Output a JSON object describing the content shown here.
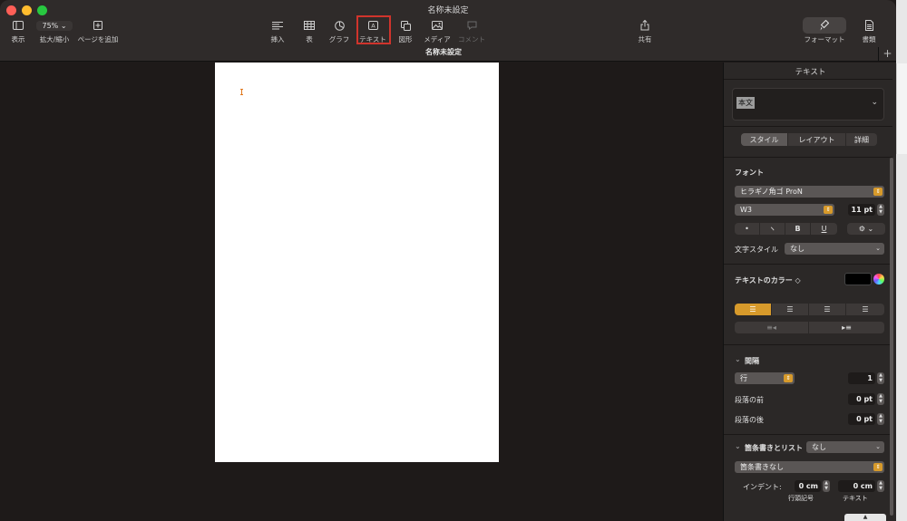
{
  "window": {
    "title": "名称未設定"
  },
  "toolbar": {
    "view_label": "表示",
    "zoom_value": "75%",
    "zoom_label": "拡大/縮小",
    "add_page_label": "ページを追加",
    "insert_label": "挿入",
    "table_label": "表",
    "chart_label": "グラフ",
    "text_label": "テキスト",
    "shape_label": "図形",
    "media_label": "メディア",
    "comment_label": "コメント",
    "share_label": "共有",
    "format_label": "フォーマット",
    "document_label": "書類"
  },
  "document": {
    "tab_title": "名称未設定"
  },
  "inspector": {
    "title": "テキスト",
    "paragraph_style": "本文",
    "tabs": [
      "スタイル",
      "レイアウト",
      "詳細"
    ],
    "font_header": "フォント",
    "font_name": "ヒラギノ角ゴ ProN",
    "font_weight": "W3",
    "font_size": "11 pt",
    "char_style_label": "文字スタイル",
    "char_style_value": "なし",
    "text_color_label": "テキストのカラー ◇",
    "spacing_header": "間隔",
    "line_mode": "行",
    "line_value": "1",
    "before_para_label": "段落の前",
    "before_para_value": "0 pt",
    "after_para_label": "段落の後",
    "after_para_value": "0 pt",
    "bullets_header": "箇条書きとリスト",
    "bullets_value": "なし",
    "bullets_preset": "箇条書きなし",
    "indent_label": "インデント:",
    "indent_bullet_value": "0 cm",
    "indent_text_value": "0 cm",
    "indent_bullet_caption": "行頭記号",
    "indent_text_caption": "テキスト"
  },
  "colors": {
    "accent": "#d79a2b",
    "highlight_box": "#d0342c"
  }
}
